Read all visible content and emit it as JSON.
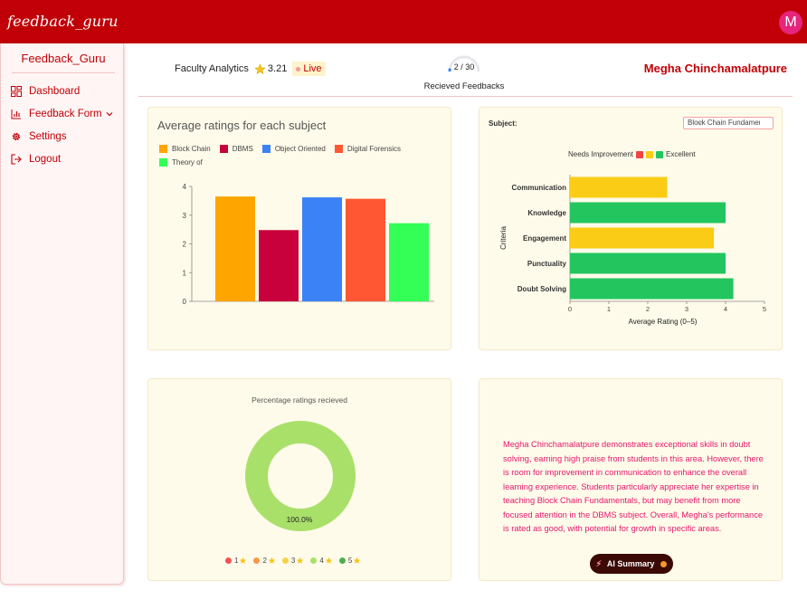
{
  "app": {
    "logo": "feedback_guru",
    "avatar_letter": "M"
  },
  "sidebar": {
    "title": "Feedback_Guru",
    "items": [
      {
        "label": "Dashboard",
        "icon": "dashboard-grid-icon"
      },
      {
        "label": "Feedback Form",
        "icon": "bar-chart-icon",
        "has_dropdown": true
      },
      {
        "label": "Settings",
        "icon": "gear-icon"
      },
      {
        "label": "Logout",
        "icon": "logout-icon"
      }
    ]
  },
  "header": {
    "title": "Faculty Analytics",
    "rating": "3.21",
    "live": "Live",
    "feedback_count": "2 / 30",
    "feedback_received": 2,
    "feedback_total": 30,
    "feedback_label": "Recieved Feedbacks",
    "teacher_name": "Megha Chinchamalatpure"
  },
  "subject_chart": {
    "title": "Average ratings for each subject",
    "chart_data": {
      "type": "bar",
      "title": "Average ratings for each subject",
      "categories": [
        "Block Chain",
        "DBMS",
        "Object Oriented",
        "Digital Forensics",
        "Theory of"
      ],
      "values": [
        3.65,
        2.48,
        3.62,
        3.57,
        2.72
      ],
      "colors": [
        "#ffa500",
        "#c8003c",
        "#3b82f6",
        "#ff5733",
        "#33ff57"
      ],
      "ylim": [
        0,
        4
      ],
      "yticks": [
        "0",
        "1",
        "2",
        "3",
        "4"
      ],
      "legend": "top",
      "grid": false
    }
  },
  "criteria_chart": {
    "subject_label": "Subject:",
    "selected_subject": "Block Chain Fundamentals",
    "legend_low": "Needs Improvement",
    "legend_high": "Excellent",
    "legend_colors": [
      "#ef4444",
      "#facc15",
      "#22c55e"
    ],
    "chart_data": {
      "type": "bar",
      "orientation": "horizontal",
      "categories": [
        "Communication",
        "Knowledge",
        "Engagement",
        "Punctuality",
        "Doubt Solving"
      ],
      "values": [
        2.5,
        4.0,
        3.7,
        4.0,
        4.2
      ],
      "colors": [
        "#facc15",
        "#22c55e",
        "#facc15",
        "#22c55e",
        "#22c55e"
      ],
      "xlabel": "Average Rating (0–5)",
      "ylabel": "Criteria",
      "xlim": [
        0,
        5
      ],
      "xticks": [
        "0",
        "1",
        "2",
        "3",
        "4",
        "5"
      ],
      "grid": false
    }
  },
  "donut_chart": {
    "title": "Percentage ratings recieved",
    "center_label": "100.0%",
    "chart_data": {
      "type": "pie",
      "title": "Percentage ratings recieved",
      "categories": [
        "1",
        "2",
        "3",
        "4",
        "5"
      ],
      "values": [
        0,
        0,
        0,
        100,
        0
      ],
      "colors": [
        "#f25252",
        "#f59a4a",
        "#f5d24a",
        "#a9e06a",
        "#4caf50"
      ],
      "legend": "bottom"
    }
  },
  "ai_summary": {
    "text": "Megha Chinchamalatpure demonstrates exceptional skills in doubt solving, earning high praise from students in this area. However, there is room for improvement in communication to enhance the overall learning experience. Students particularly appreciate her expertise in teaching Block Chain Fundamentals, but may benefit from more focused attention in the DBMS subject. Overall, Megha's performance is rated as good, with potential for growth in specific areas.",
    "button_label": "AI Summary"
  },
  "colors": {
    "brand": "#c00006",
    "card_bg": "#fffbea",
    "summary_text": "#e3176d"
  }
}
